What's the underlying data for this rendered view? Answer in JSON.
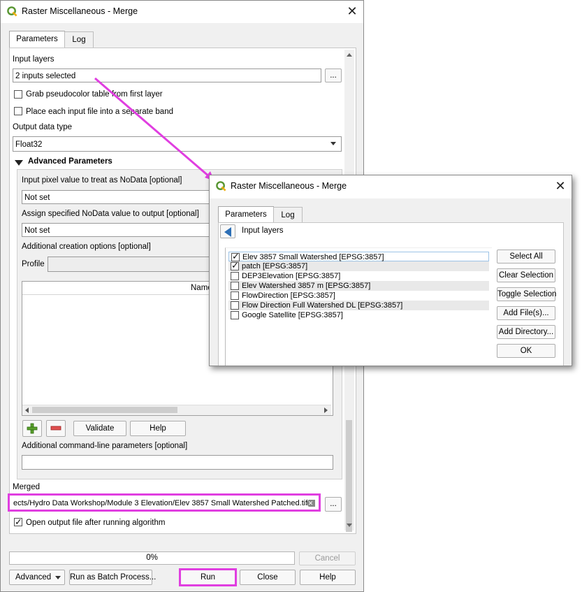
{
  "main_dialog": {
    "title": "Raster Miscellaneous - Merge",
    "tabs": [
      "Parameters",
      "Log"
    ],
    "input_layers_label": "Input layers",
    "input_layers_value": "2 inputs selected",
    "browse_label": "...",
    "grab_pseudocolor_label": "Grab pseudocolor table from first layer",
    "place_each_input_label": "Place each input file into a separate band",
    "output_data_type_label": "Output data type",
    "output_data_type_value": "Float32",
    "advanced_params_label": "Advanced Parameters",
    "nodata_input_label": "Input pixel value to treat as NoData [optional]",
    "nodata_input_value": "Not set",
    "nodata_output_label": "Assign specified NoData value to output [optional]",
    "nodata_output_value": "Not set",
    "creation_options_label": "Additional creation options [optional]",
    "profile_label": "Profile",
    "table_name_header": "Name",
    "validate_label": "Validate",
    "help_small_label": "Help",
    "extra_params_label": "Additional command-line parameters [optional]",
    "extra_params_value": "",
    "merged_label": "Merged",
    "merged_value": "ects/Hydro Data Workshop/Module 3 Elevation/Elev 3857 Small Watershed Patched.tif",
    "open_output_label": "Open output file after running algorithm",
    "open_output_checked": true,
    "progress_text": "0%",
    "progress_percent": 0,
    "cancel_label": "Cancel",
    "advanced_label": "Advanced",
    "batch_label": "Run as Batch Process...",
    "run_label": "Run",
    "close_label": "Close",
    "help_label": "Help"
  },
  "popup_dialog": {
    "title": "Raster Miscellaneous - Merge",
    "tabs": [
      "Parameters",
      "Log"
    ],
    "header_label": "Input layers",
    "layers": [
      {
        "name": "Elev 3857 Small Watershed [EPSG:3857]",
        "checked": true
      },
      {
        "name": "patch [EPSG:3857]",
        "checked": true
      },
      {
        "name": "DEP3Elevation [EPSG:3857]",
        "checked": false
      },
      {
        "name": "Elev Watershed 3857 m [EPSG:3857]",
        "checked": false
      },
      {
        "name": "FlowDirection [EPSG:3857]",
        "checked": false
      },
      {
        "name": "Flow Direction Full Watershed DL [EPSG:3857]",
        "checked": false
      },
      {
        "name": "Google Satellite [EPSG:3857]",
        "checked": false
      }
    ],
    "buttons": {
      "select_all": "Select All",
      "clear_selection": "Clear Selection",
      "toggle_selection": "Toggle Selection",
      "add_files": "Add File(s)...",
      "add_directory": "Add Directory...",
      "ok": "OK"
    }
  },
  "colors": {
    "highlight": "#e03ee0",
    "qgis_green": "#589632",
    "qgis_yellow": "#ee7913"
  }
}
